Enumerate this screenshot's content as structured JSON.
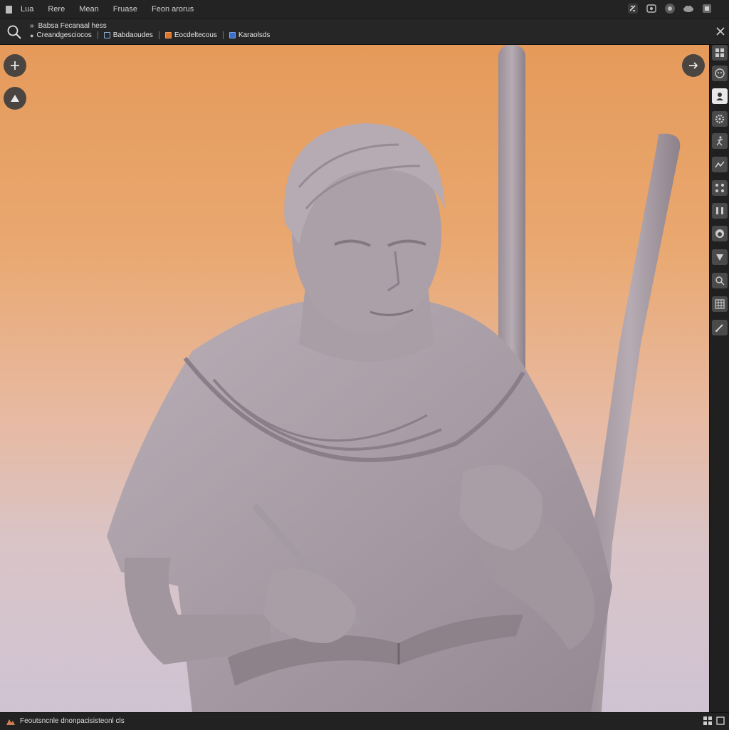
{
  "menubar": {
    "items": [
      "Lua",
      "Rere",
      "Mean",
      "Fruase",
      "Feon arorus"
    ]
  },
  "toolbar": {
    "path": "Babsa Fecanaal hess",
    "tabs": [
      {
        "label": "Creandgesciocos",
        "icon": "dot"
      },
      {
        "label": "Babdaoudes",
        "icon": "checkbox"
      },
      {
        "label": "Eocdeltecous",
        "icon": "orange-square"
      },
      {
        "label": "Karaolsds",
        "icon": "blue-square"
      }
    ]
  },
  "viewport": {
    "subject": "sculpted figure holding staff and open book"
  },
  "tool_strip": {
    "tools": [
      "grid-icon",
      "face-icon",
      "portrait-icon",
      "gear-icon",
      "figure-icon",
      "wave-icon",
      "nodes-icon",
      "columns-icon",
      "head-icon",
      "triangle-down-icon",
      "search-icon",
      "table-icon",
      "brush-icon"
    ],
    "active_index": 2
  },
  "statusbar": {
    "text": "Feoutsncnle dnonpacisisteonl cls"
  },
  "colors": {
    "chrome_bg": "#232323",
    "viewport_top": "#e59a5a",
    "viewport_bottom": "#cfc3d3",
    "sculpt": "#a89ca4"
  }
}
